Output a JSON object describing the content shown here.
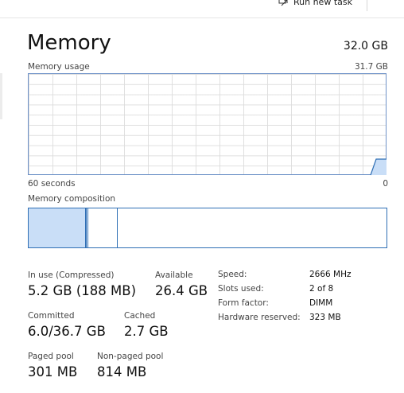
{
  "command_bar": {
    "run_new_task_label": "Run new task"
  },
  "header": {
    "title": "Memory",
    "total": "32.0 GB"
  },
  "usage_graph": {
    "label": "Memory usage",
    "max_label": "31.7 GB",
    "axis_left": "60 seconds",
    "axis_right": "0",
    "line_color": "#2f6fb5",
    "fill_color": "#c9def7"
  },
  "composition": {
    "label": "Memory composition",
    "in_use_fraction": 0.162,
    "modified_fraction": 0.004,
    "standby_fraction": 0.084,
    "in_use_color": "#c9def7",
    "border_color": "#2f6fb5"
  },
  "stats": {
    "in_use": {
      "label": "In use (Compressed)",
      "value": "5.2 GB (188 MB)"
    },
    "available": {
      "label": "Available",
      "value": "26.4 GB"
    },
    "committed": {
      "label": "Committed",
      "value": "6.0/36.7 GB"
    },
    "cached": {
      "label": "Cached",
      "value": "2.7 GB"
    },
    "paged_pool": {
      "label": "Paged pool",
      "value": "301 MB"
    },
    "non_paged_pool": {
      "label": "Non-paged pool",
      "value": "814 MB"
    }
  },
  "details": [
    {
      "key": "Speed:",
      "value": "2666 MHz"
    },
    {
      "key": "Slots used:",
      "value": "2 of 8"
    },
    {
      "key": "Form factor:",
      "value": "DIMM"
    },
    {
      "key": "Hardware reserved:",
      "value": "323 MB"
    }
  ]
}
